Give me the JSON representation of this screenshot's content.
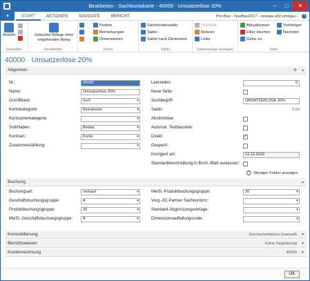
{
  "window": {
    "title": "Bearbeiten - Sachkontokarte - 40000 · Umsatzerlöse 20%"
  },
  "menu": {
    "tabs": [
      "START",
      "AKTIONEN",
      "NAVIGATE",
      "BERICHT"
    ],
    "company": "Pro-Bau - NavBau2017 - omega-s50.omega.l...",
    "help": "?"
  },
  "ribbon": {
    "groups": {
      "verwalten": "Verwalten",
      "verarbeiten": "Verarbeiten",
      "konto": "Konto",
      "saldo": "Saldo",
      "datenanlage": "Datenanlage anzeigen",
      "seite": "Seite"
    },
    "ansicht": "Ansicht",
    "gebuchte": "Gebuchte Belege ohne eingehenden Beleg",
    "posten": "Posten",
    "bemerkungen": "Bemerkungen",
    "dimensionen": "Dimensionen",
    "sachkontensaldo": "Sachkontensaldo",
    "saldo": "Saldo",
    "saldo_dim": "Saldo nach Dimension",
    "onenote": "OneNote",
    "notizen": "Notizen",
    "links": "Links",
    "aktualisieren": "Aktualisieren",
    "filter": "Filter löschen",
    "gehe_zu": "Gehe zu",
    "vorheriger": "Vorheriger",
    "naechster": "Nächster"
  },
  "headline": "40000 · Umsatzerlöse 20%",
  "allgemein": {
    "title": "Allgemein",
    "nr_label": "Nr.:",
    "nr": "40000",
    "name_label": "Name:",
    "name": "Umsatzerlöse 20%",
    "guv_label": "GuV/Bilanz:",
    "guv": "GuV",
    "kontokategorie_label": "Kontokategorie:",
    "kontokategorie": "Einnahmen",
    "kontounterkategorie_label": "Kontounterkategorie:",
    "kontounterkategorie": "",
    "sollhaben_label": "Soll/Haben:",
    "sollhaben": "Beides",
    "kontoart_label": "Kontoart:",
    "kontoart": "Konto",
    "zusammen_label": "Zusammenzählung:",
    "zusammen": "",
    "leerzeilen_label": "Leerzeilen:",
    "leerzeilen": "0",
    "neueseite_label": "Neue Seite:",
    "suchbegriff_label": "Suchbegriff:",
    "suchbegriff": "UMSATZERLÖSE 20%",
    "saldo_label": "Saldo:",
    "saldo": "0,00",
    "abstimmbar_label": "Abstimmbar:",
    "automat_label": "Automat. Textbaustein:",
    "direkt_label": "Direkt:",
    "gesperrt_label": "Gesperrt:",
    "korrigiert_label": "Korrigiert am:",
    "korrigiert": "12.12.2019",
    "standard_label": "Standardbeschreibung in Buch.-Blatt auslassen:",
    "weniger": "Weniger Felder anzeigen"
  },
  "buchung": {
    "title": "Buchung",
    "buchungsart_label": "Buchungsart:",
    "buchungsart": "Verkauf",
    "geschbuch_label": "Geschäftsbuchungsgruppe:",
    "geschbuch": "A",
    "prodbuch_label": "Produktbuchungsgruppe:",
    "prodbuch": "20",
    "mwstgesch_label": "MwSt.-Geschäftsbuchungsgruppe:",
    "mwstgesch": "A",
    "mwstprod_label": "MwSt.-Produktbuchungsgruppe:",
    "mwstprod": "20",
    "vorg_label": "Vorg.-/IC-Partner Sachkontonr.:",
    "vorg": "",
    "standardabgr_label": "Standard-Abgrenzungsvorlage:",
    "standardabgr": "",
    "dimension_label": "Dimensionsaufteilungscode:",
    "dimension": ""
  },
  "collapsed": {
    "konsolidierung": "Konsolidierung",
    "konsolidierung_summary": "Durchschnittskurs (manuell)",
    "berichtswesen": "Berichtswesen",
    "berichtswesen_summary": "Keine Regulierung",
    "kostenrechnung": "Kostenrechnung",
    "kostenrechnung_summary": "40000"
  },
  "footer": {
    "ok": "OK"
  }
}
